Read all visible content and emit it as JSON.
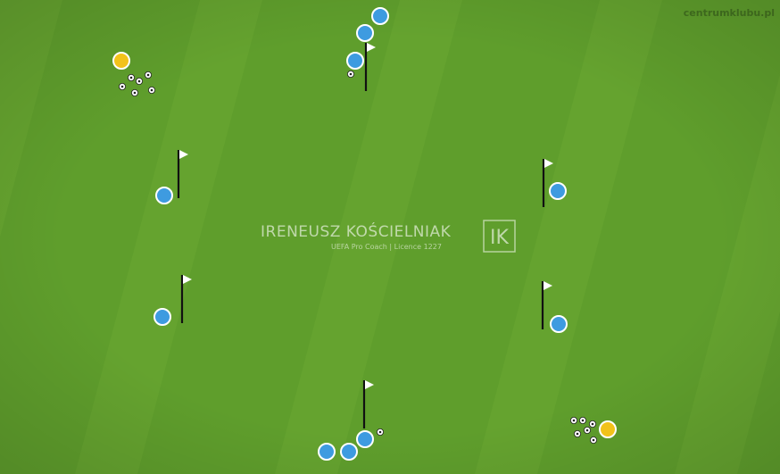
{
  "watermark": {
    "site": "centrumklubu.pl",
    "coach_name": "IRENEUSZ KOŚCIELNIAK",
    "coach_subtitle": "UEFA Pro Coach   |   Licence 1227",
    "logo_letters": "IK"
  },
  "colors": {
    "pitch": "#5f9e2c",
    "stripe_light": "#6aa833",
    "player_blue": "#3e9be0",
    "player_yellow": "#f2c21a",
    "pole": "#111111",
    "flag": "#ffffff"
  },
  "diagram": {
    "flag_icon": "flag-pole-icon",
    "player_icon": "player-marker-icon",
    "ball_icon": "soccer-ball-icon"
  }
}
